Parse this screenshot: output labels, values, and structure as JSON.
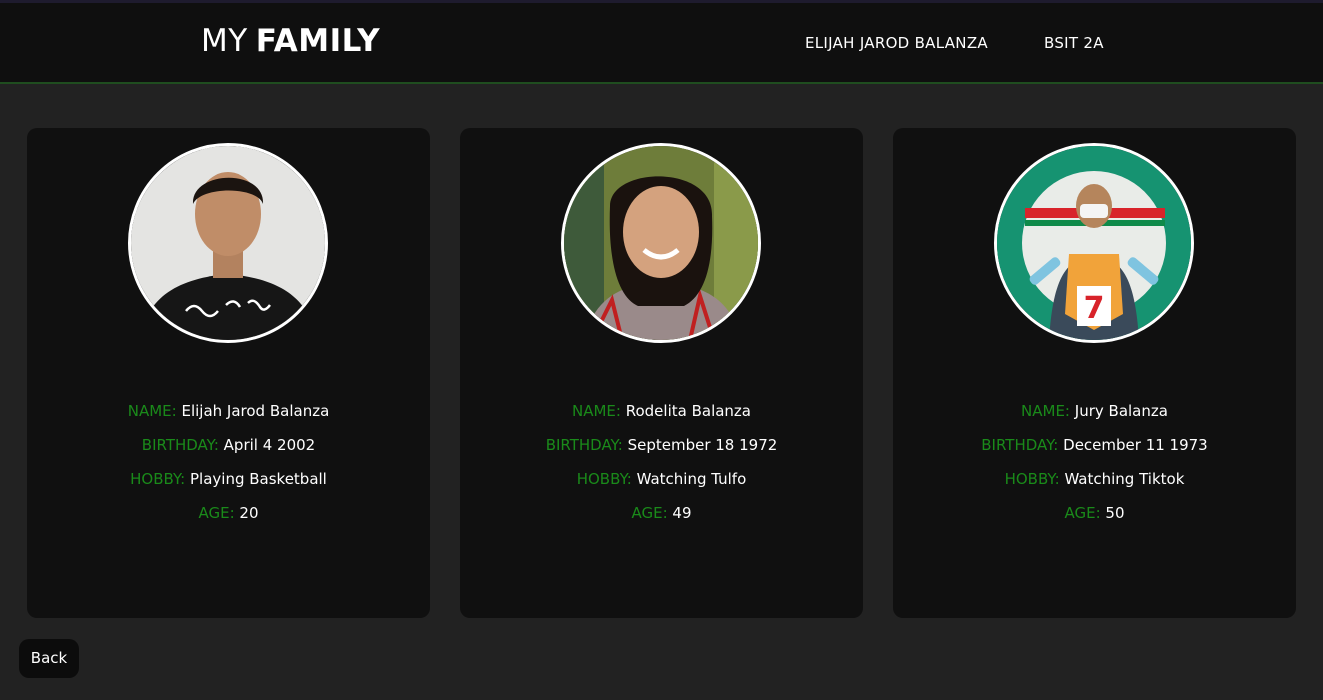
{
  "header": {
    "logo_thin": "MY",
    "logo_bold": "FAMILY",
    "nav": {
      "name": "ELIJAH JAROD BALANZA",
      "section": "BSIT 2A"
    }
  },
  "labels": {
    "name": "NAME:",
    "birthday": "BIRTHDAY:",
    "hobby": "HOBBY:",
    "age": "AGE:"
  },
  "members": [
    {
      "name": "Elijah Jarod Balanza",
      "birthday": "April 4 2002",
      "hobby": "Playing Basketball",
      "age": "20"
    },
    {
      "name": "Rodelita Balanza",
      "birthday": "September 18 1972",
      "hobby": "Watching Tulfo",
      "age": "49"
    },
    {
      "name": "Jury Balanza",
      "birthday": "December 11 1973",
      "hobby": "Watching Tiktok",
      "age": "50"
    }
  ],
  "back_label": "Back",
  "colors": {
    "accent": "#1a8a1a",
    "background": "#222222",
    "card": "#101010",
    "header": "#0f0f0f"
  }
}
